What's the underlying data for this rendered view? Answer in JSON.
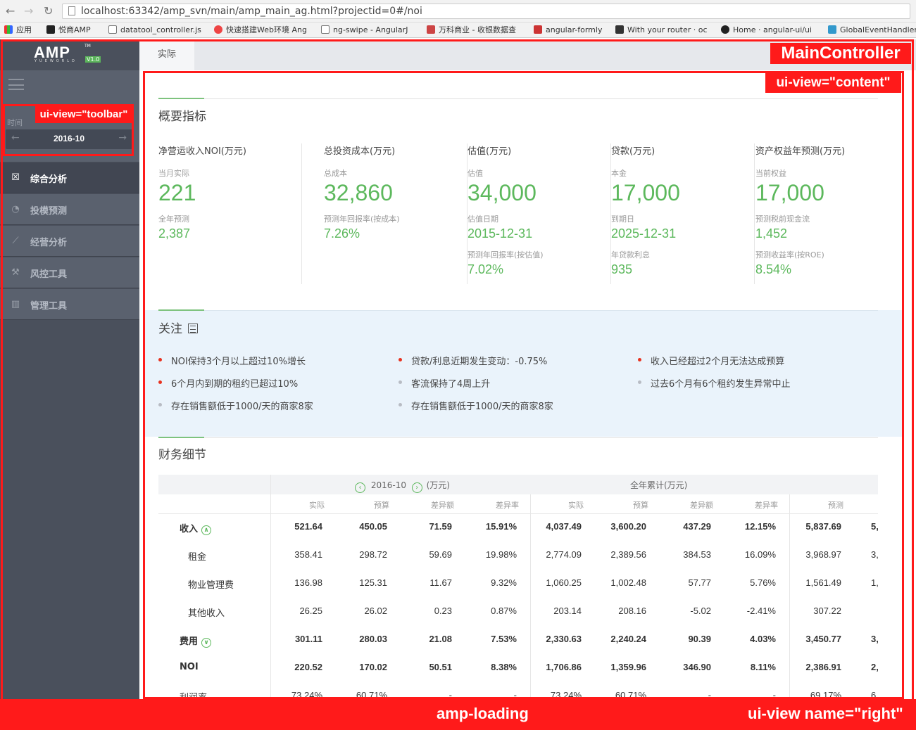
{
  "browser": {
    "url": "localhost:63342/amp_svn/main/amp_main_ag.html?projectid=0#/noi",
    "bookmarks": [
      "应用",
      "悦商AMP",
      "datatool_controller.js",
      "快速搭建Web环境 Ang",
      "ng-swipe - AngularJ",
      "万科商业 - 收银数据查",
      "angular-formly",
      "With your router · oc",
      "Home · angular-ui/ui",
      "GlobalEventHandler"
    ]
  },
  "sidebar": {
    "logo": "AMP",
    "logo_tm": "TM",
    "logo_sub": "YUEWORLD",
    "version": "V1.0",
    "time_label": "时间",
    "date": "2016-10",
    "items": [
      {
        "label": "综合分析",
        "active": true
      },
      {
        "label": "投模预测",
        "active": false
      },
      {
        "label": "经营分析",
        "active": false
      },
      {
        "label": "风控工具",
        "active": false
      },
      {
        "label": "管理工具",
        "active": false
      }
    ]
  },
  "tabs": {
    "actual": "实际"
  },
  "overview": {
    "title": "概要指标",
    "kpis": [
      {
        "head": "净营运收入NOI(万元)",
        "l1": "当月实际",
        "v1": "221",
        "l2": "全年预测",
        "v2": "2,387",
        "l3": "",
        "v3": ""
      },
      {
        "head": "总投资成本(万元)",
        "l1": "总成本",
        "v1": "32,860",
        "l2": "预测年回报率(按成本)",
        "v2": "7.26%",
        "l3": "",
        "v3": ""
      },
      {
        "head": "估值(万元)",
        "l1": "估值",
        "v1": "34,000",
        "l2": "估值日期",
        "v2": "2015-12-31",
        "l3": "预测年回报率(按估值)",
        "v3": "7.02%"
      },
      {
        "head": "贷款(万元)",
        "l1": "本金",
        "v1": "17,000",
        "l2": "到期日",
        "v2": "2025-12-31",
        "l3": "年贷款利息",
        "v3": "935"
      },
      {
        "head": "资产权益年预测(万元)",
        "l1": "当前权益",
        "v1": "17,000",
        "l2": "预测税前现金流",
        "v2": "1,452",
        "l3": "预测收益率(按ROE)",
        "v3": "8.54%"
      }
    ]
  },
  "focus": {
    "title": "关注",
    "alerts": [
      {
        "text": "NOI保持3个月以上超过10%增长",
        "color": "#e8321f"
      },
      {
        "text": "贷款/利息近期发生变动：-0.75%",
        "color": "#e8321f"
      },
      {
        "text": "收入已经超过2个月无法达成预算",
        "color": "#e8321f"
      },
      {
        "text": "6个月内到期的租约已超过10%",
        "color": "#e8321f"
      },
      {
        "text": "客流保持了4周上升",
        "color": "#b8bcc4"
      },
      {
        "text": "过去6个月有6个租约发生异常中止",
        "color": "#b8bcc4"
      },
      {
        "text": "存在销售额低于1000/天的商家8家",
        "color": "#b8bcc4"
      },
      {
        "text": "存在销售额低于1000/天的商家8家",
        "color": "#b8bcc4"
      }
    ]
  },
  "finance": {
    "title": "财务细节",
    "period": "2016-10",
    "unit": "(万元)",
    "annual_label": "全年累计(万元)",
    "headers": [
      "实际",
      "预算",
      "差异额",
      "差异率",
      "实际",
      "预算",
      "差异额",
      "差异率",
      "预测"
    ],
    "rows": [
      {
        "label": "收入",
        "bold": true,
        "toggle": "∧",
        "values": [
          "521.64",
          "450.05",
          "71.59",
          "15.91%",
          "4,037.49",
          "3,600.20",
          "437.29",
          "12.15%",
          "5,837.69",
          "5,"
        ]
      },
      {
        "label": "租金",
        "bold": false,
        "toggle": "",
        "values": [
          "358.41",
          "298.72",
          "59.69",
          "19.98%",
          "2,774.09",
          "2,389.56",
          "384.53",
          "16.09%",
          "3,968.97",
          "3,"
        ]
      },
      {
        "label": "物业管理费",
        "bold": false,
        "toggle": "",
        "values": [
          "136.98",
          "125.31",
          "11.67",
          "9.32%",
          "1,060.25",
          "1,002.48",
          "57.77",
          "5.76%",
          "1,561.49",
          "1,"
        ]
      },
      {
        "label": "其他收入",
        "bold": false,
        "toggle": "",
        "values": [
          "26.25",
          "26.02",
          "0.23",
          "0.87%",
          "203.14",
          "208.16",
          "-5.02",
          "-2.41%",
          "307.22",
          ""
        ]
      },
      {
        "label": "费用",
        "bold": true,
        "toggle": "∨",
        "values": [
          "301.11",
          "280.03",
          "21.08",
          "7.53%",
          "2,330.63",
          "2,240.24",
          "90.39",
          "4.03%",
          "3,450.77",
          "3,"
        ]
      },
      {
        "label": "NOI",
        "bold": true,
        "toggle": "",
        "values": [
          "220.52",
          "170.02",
          "50.51",
          "8.38%",
          "1,706.86",
          "1,359.96",
          "346.90",
          "8.11%",
          "2,386.91",
          "2,"
        ]
      },
      {
        "label": "利润率",
        "bold": false,
        "toggle": "",
        "values": [
          "73.24%",
          "60.71%",
          "-",
          "-",
          "73.24%",
          "60.71%",
          "-",
          "-",
          "69.17%",
          "6"
        ]
      }
    ]
  },
  "annotations": {
    "main_controller": "MainController",
    "content": "ui-view=\"content\"",
    "toolbar": "ui-view=\"toolbar\"",
    "loading": "amp-loading",
    "right": "ui-view name=\"right\""
  },
  "colors": {
    "accent": "#5cb85c",
    "alert": "#e8321f",
    "annotation": "#ff1a1a",
    "sidebar": "#4a505c"
  }
}
